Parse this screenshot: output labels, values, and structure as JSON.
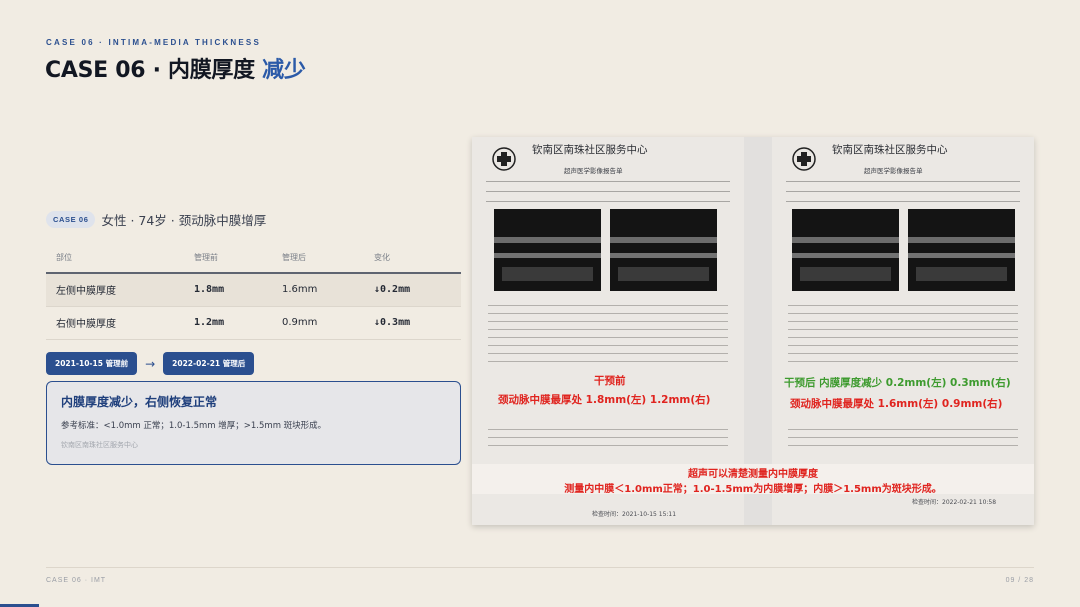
{
  "header": {
    "kicker": "CASE 06 · INTIMA-MEDIA THICKNESS",
    "title_main": "CASE 06 · 内膜厚度 ",
    "title_accent": "减少"
  },
  "patient": {
    "case_badge": "CASE 06",
    "summary": "女性 · 74岁 · 颈动脉中膜增厚"
  },
  "table": {
    "headers": [
      "部位",
      "管理前",
      "管理后",
      "变化"
    ],
    "rows": [
      {
        "site": "左侧中膜厚度",
        "before": "1.8mm",
        "after": "1.6mm",
        "change": "↓0.2mm"
      },
      {
        "site": "右侧中膜厚度",
        "before": "1.2mm",
        "after": "0.9mm",
        "change": "↓0.3mm"
      }
    ]
  },
  "dates": {
    "before": "2021-10-15 管理前",
    "arrow": "→",
    "after": "2022-02-21 管理后"
  },
  "callout": {
    "title": "内膜厚度减少，右侧恢复正常",
    "reference": "参考标准：<1.0mm 正常；1.0-1.5mm 增厚；>1.5mm 斑块形成。",
    "source": "钦南区南珠社区服务中心"
  },
  "photo": {
    "center_name": "钦南区南珠社区服务中心",
    "report_title": "超声医学影像报告单",
    "left_label": "干预前",
    "left_values": "颈动脉中膜最厚处  1.8mm(左)  1.2mm(右)",
    "right_label": "干预后  内膜厚度减少  0.2mm(左) 0.3mm(右)",
    "right_values": "颈动脉中膜最厚处   1.6mm(左)  0.9mm(右)",
    "banner_line1": "超声可以清楚测量内中膜厚度",
    "banner_line2": "测量内中膜＜1.0mm正常；1.0-1.5mm为内膜增厚；内膜＞1.5mm为斑块形成。",
    "left_exam_time": "检查时间：2021-10-15 15:11",
    "right_exam_time": "检查时间：2022-02-21 10:58"
  },
  "footer": {
    "left": "CASE 06 · IMT",
    "page": "09 / 28"
  },
  "progress_fraction": 0.036,
  "colors": {
    "accent": "#2b4f8f",
    "decrease_green": "#2f8a4a",
    "annotation_red": "#e0241f",
    "annotation_green": "#3e9b2f"
  }
}
